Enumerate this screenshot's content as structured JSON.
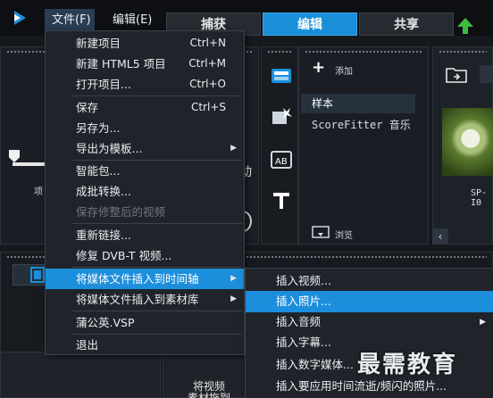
{
  "menubar": {
    "file_label": "文件(F)",
    "edit_label": "编辑(E)"
  },
  "tabs": [
    "捕获",
    "编辑",
    "共享"
  ],
  "library": {
    "add_label": "添加",
    "items": [
      "样本",
      "ScoreFitter 音乐"
    ],
    "browse_label": "浏览",
    "thumb_label": "SP-I0"
  },
  "file_menu": {
    "items": [
      {
        "label": "新建项目",
        "shortcut": "Ctrl+N"
      },
      {
        "label": "新建 HTML5 项目",
        "shortcut": "Ctrl+M"
      },
      {
        "label": "打开项目...",
        "shortcut": "Ctrl+O"
      },
      {
        "label": "保存",
        "shortcut": "Ctrl+S"
      },
      {
        "label": "另存为...",
        "shortcut": ""
      },
      {
        "label": "导出为模板...",
        "shortcut": ""
      },
      {
        "label": "智能包...",
        "shortcut": ""
      },
      {
        "label": "成批转换...",
        "shortcut": ""
      },
      {
        "label": "保存修整后的视频",
        "shortcut": ""
      },
      {
        "label": "重新链接...",
        "shortcut": ""
      },
      {
        "label": "修复 DVB-T 视频...",
        "shortcut": ""
      },
      {
        "label": "将媒体文件插入到时间轴",
        "shortcut": ""
      },
      {
        "label": "将媒体文件插入到素材库",
        "shortcut": ""
      },
      {
        "label": "蒲公英.VSP",
        "shortcut": ""
      },
      {
        "label": "退出",
        "shortcut": ""
      }
    ]
  },
  "submenu": {
    "items": [
      "插入视频...",
      "插入照片...",
      "插入音频",
      "插入字幕...",
      "插入数字媒体...",
      "插入要应用时间流逝/频闪的照片..."
    ]
  },
  "timeline": {
    "hint_line1": "将视频",
    "hint_line2": "素材拖到"
  },
  "preview": {
    "text_a": "项",
    "text_b": "动"
  },
  "watermark": "最需教育",
  "colors": {
    "accent": "#1c8edb",
    "menu_bg": "#20242a"
  }
}
